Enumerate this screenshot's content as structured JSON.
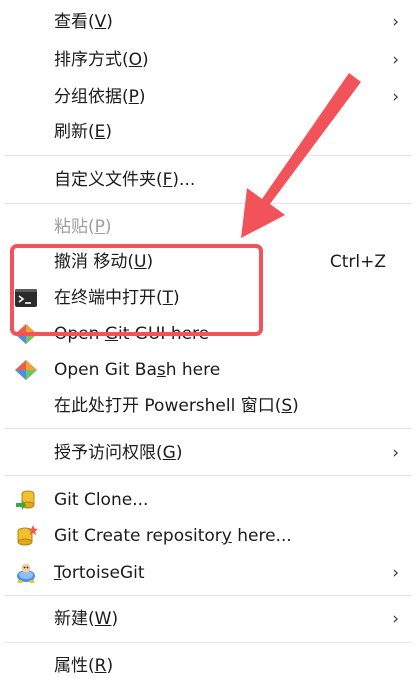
{
  "menu": {
    "view": {
      "label": "查看(V)",
      "key": "V"
    },
    "sort": {
      "label": "排序方式(O)",
      "key": "O"
    },
    "group": {
      "label": "分组依据(P)",
      "key": "P"
    },
    "refresh": {
      "label": "刷新(E)",
      "key": "E"
    },
    "customize": {
      "label": "自定义文件夹(F)...",
      "key": "F"
    },
    "paste": {
      "label": "粘贴(P)",
      "key": "P"
    },
    "undo": {
      "label": "撤消 移动(U)",
      "key": "U",
      "shortcut": "Ctrl+Z"
    },
    "terminal": {
      "label": "在终端中打开(T)",
      "key": "T"
    },
    "git_gui": {
      "label": "Open Git GUI here",
      "key": "G"
    },
    "git_bash": {
      "label": "Open Git Bash here",
      "key": "s"
    },
    "powershell": {
      "label": "在此处打开 Powershell 窗口(S)",
      "key": "S"
    },
    "grant_access": {
      "label": "授予访问权限(G)",
      "key": "G"
    },
    "git_clone": {
      "label": "Git Clone..."
    },
    "git_create": {
      "label": "Git Create repository here...",
      "key": "y"
    },
    "tortoisegit": {
      "label": "TortoiseGit",
      "key": "T"
    },
    "new": {
      "label": "新建(W)",
      "key": "W"
    },
    "properties": {
      "label": "属性(R)",
      "key": "R"
    }
  },
  "submenu_arrow": "›",
  "colors": {
    "annotation": "#f2525a",
    "text": "#1b1b1b",
    "disabled_text": "#9e9e9e",
    "separator": "#e6e6e6"
  },
  "icons": [
    "terminal-icon",
    "git-gui-icon",
    "git-bash-icon",
    "git-clone-icon",
    "git-create-repo-icon",
    "tortoisegit-icon"
  ]
}
